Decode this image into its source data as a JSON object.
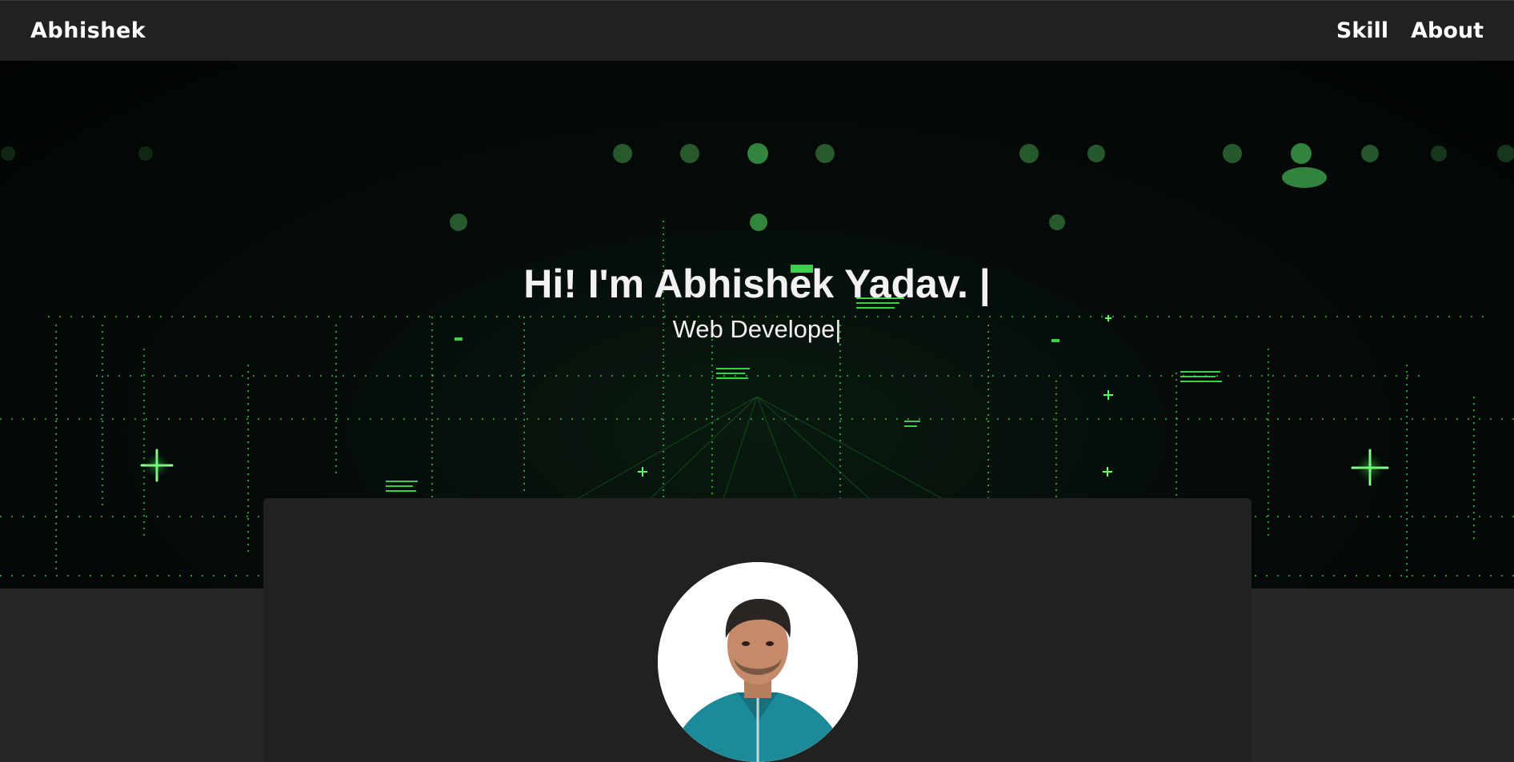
{
  "navbar": {
    "brand": "Abhishek",
    "links": [
      {
        "label": "Skill"
      },
      {
        "label": "About"
      }
    ]
  },
  "hero": {
    "title": "Hi! I'm Abhishek Yadav. |",
    "subtitle": "Web Develope|",
    "background": "matrix-digital-rain",
    "accent": "#39ff4a"
  },
  "about": {
    "avatar_alt": "profile-photo"
  }
}
